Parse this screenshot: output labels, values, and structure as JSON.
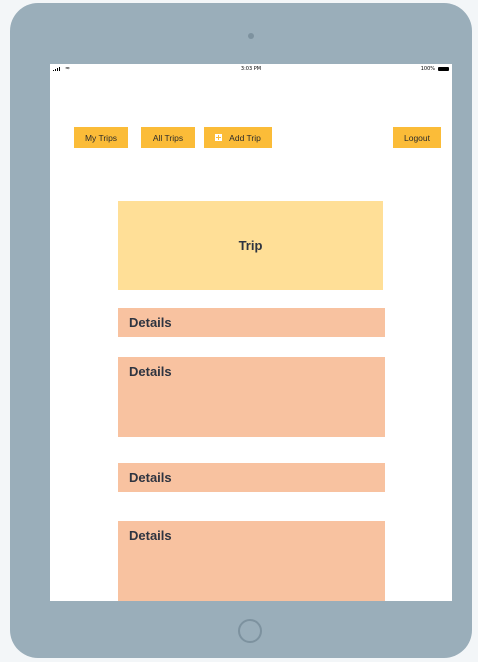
{
  "status_bar": {
    "wifi_icon": "≈",
    "time": "3:03 PM",
    "battery": "100%"
  },
  "nav": {
    "my_trips": "My Trips",
    "all_trips": "All Trips",
    "add_trip": "Add Trip",
    "logout": "Logout"
  },
  "trip": {
    "title": "Trip"
  },
  "details": [
    {
      "label": "Details"
    },
    {
      "label": "Details"
    },
    {
      "label": "Details"
    },
    {
      "label": "Details"
    }
  ],
  "colors": {
    "button": "#fbbc38",
    "trip_card": "#ffdf97",
    "details_card": "#f8c2a0",
    "device_frame": "#9aaeba"
  }
}
